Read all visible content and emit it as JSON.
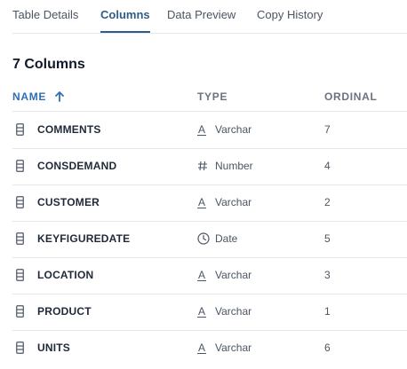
{
  "tabs": [
    {
      "label": "Table Details",
      "active": false
    },
    {
      "label": "Columns",
      "active": true
    },
    {
      "label": "Data Preview",
      "active": false
    },
    {
      "label": "Copy History",
      "active": false
    }
  ],
  "section_title": "7 Columns",
  "columns_header": {
    "name": "NAME",
    "type": "TYPE",
    "ordinal": "ORDINAL",
    "sorted_by": "name",
    "sort_direction": "ascending"
  },
  "rows": [
    {
      "name": "COMMENTS",
      "type": "Varchar",
      "type_icon": "text-type-icon",
      "ordinal": "7"
    },
    {
      "name": "CONSDEMAND",
      "type": "Number",
      "type_icon": "number-type-icon",
      "ordinal": "4"
    },
    {
      "name": "CUSTOMER",
      "type": "Varchar",
      "type_icon": "text-type-icon",
      "ordinal": "2"
    },
    {
      "name": "KEYFIGUREDATE",
      "type": "Date",
      "type_icon": "clock-type-icon",
      "ordinal": "5"
    },
    {
      "name": "LOCATION",
      "type": "Varchar",
      "type_icon": "text-type-icon",
      "ordinal": "3"
    },
    {
      "name": "PRODUCT",
      "type": "Varchar",
      "type_icon": "text-type-icon",
      "ordinal": "1"
    },
    {
      "name": "UNITS",
      "type": "Varchar",
      "type_icon": "text-type-icon",
      "ordinal": "6"
    }
  ],
  "colors": {
    "accent": "#2f5d8a",
    "sort_accent": "#2f6fb5",
    "text": "#1f2937",
    "muted": "#6b7280",
    "divider": "#e5e7eb"
  }
}
